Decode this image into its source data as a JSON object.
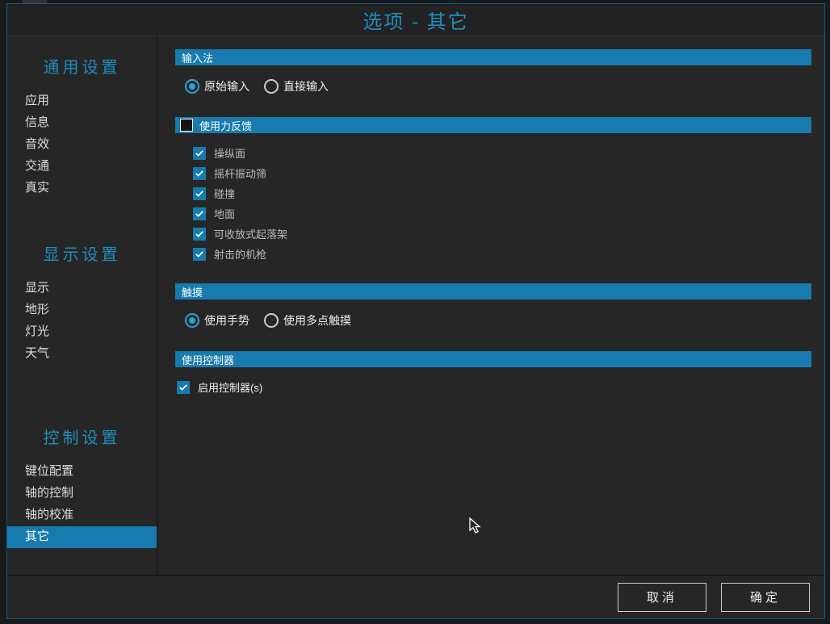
{
  "title": "选项 - 其它",
  "sidebar": {
    "groups": [
      {
        "title": "通用设置",
        "items": [
          {
            "label": "应用",
            "active": false
          },
          {
            "label": "信息",
            "active": false
          },
          {
            "label": "音效",
            "active": false
          },
          {
            "label": "交通",
            "active": false
          },
          {
            "label": "真实",
            "active": false
          }
        ]
      },
      {
        "title": "显示设置",
        "items": [
          {
            "label": "显示",
            "active": false
          },
          {
            "label": "地形",
            "active": false
          },
          {
            "label": "灯光",
            "active": false
          },
          {
            "label": "天气",
            "active": false
          }
        ]
      },
      {
        "title": "控制设置",
        "items": [
          {
            "label": "键位配置",
            "active": false
          },
          {
            "label": "轴的控制",
            "active": false
          },
          {
            "label": "轴的校准",
            "active": false
          },
          {
            "label": "其它",
            "active": true
          }
        ]
      }
    ]
  },
  "sections": {
    "input_method": {
      "title": "输入法",
      "options": [
        {
          "label": "原始输入",
          "checked": true
        },
        {
          "label": "直接输入",
          "checked": false
        }
      ]
    },
    "force_feedback": {
      "title": "使用力反馈",
      "master_checked": false,
      "items": [
        {
          "label": "操纵面",
          "checked": true
        },
        {
          "label": "摇杆振动筛",
          "checked": true
        },
        {
          "label": "碰撞",
          "checked": true
        },
        {
          "label": "地面",
          "checked": true
        },
        {
          "label": "可收放式起落架",
          "checked": true
        },
        {
          "label": "射击的机枪",
          "checked": true
        }
      ]
    },
    "touch": {
      "title": "触摸",
      "options": [
        {
          "label": "使用手势",
          "checked": true
        },
        {
          "label": "使用多点触摸",
          "checked": false
        }
      ]
    },
    "controllers": {
      "title": "使用控制器",
      "enable": {
        "label": "启用控制器(s)",
        "checked": true
      }
    }
  },
  "footer": {
    "cancel": "取消",
    "ok": "确定"
  }
}
